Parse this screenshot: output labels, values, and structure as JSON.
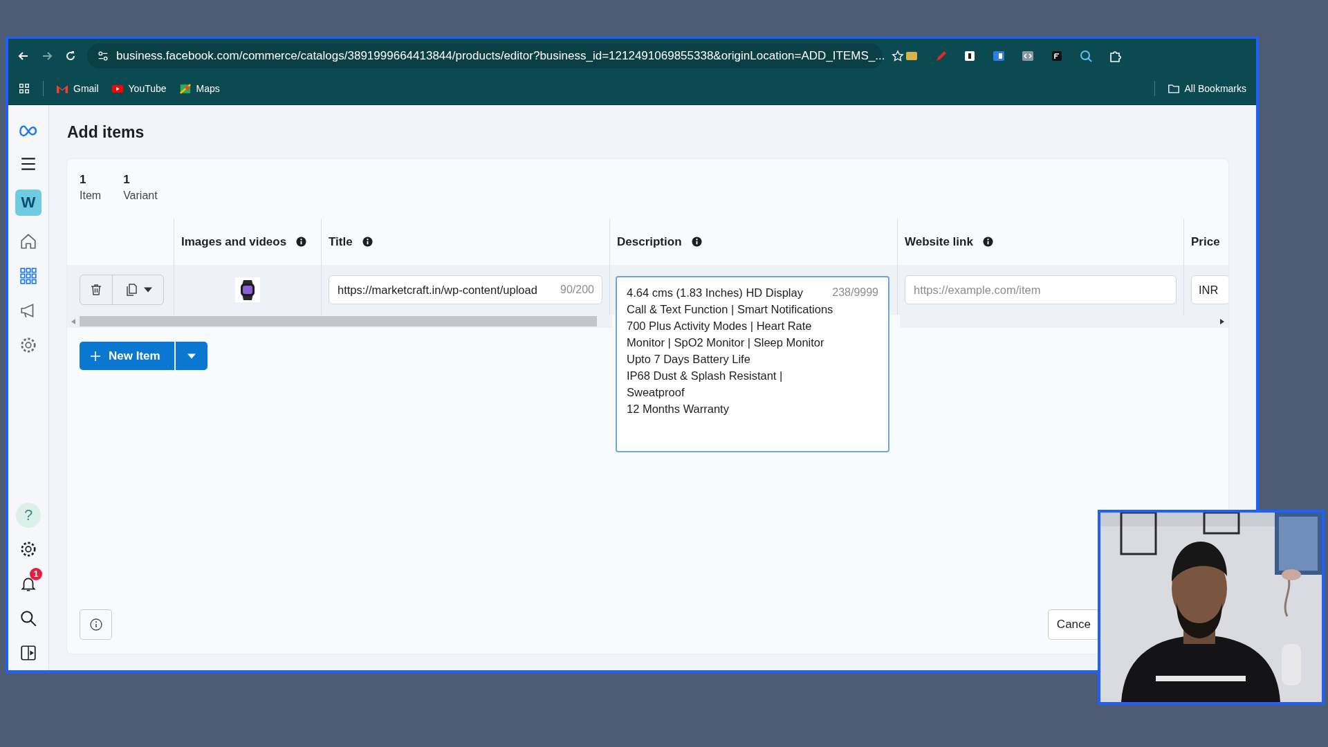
{
  "browser": {
    "url": "business.facebook.com/commerce/catalogs/3891999664413844/products/editor?business_id=1212491069855338&originLocation=ADD_ITEMS_...",
    "bookmarks": [
      {
        "label": "Gmail",
        "kind": "mail"
      },
      {
        "label": "YouTube",
        "kind": "video"
      },
      {
        "label": "Maps",
        "kind": "map"
      }
    ],
    "all_bookmarks": "All Bookmarks"
  },
  "sidebar": {
    "avatar": "W",
    "help": "?",
    "notifications": "1"
  },
  "page": {
    "title": "Add items",
    "counts": [
      {
        "value": "1",
        "label": "Item"
      },
      {
        "value": "1",
        "label": "Variant"
      }
    ],
    "table": {
      "columns": [
        {
          "label": "Images and videos",
          "info": true
        },
        {
          "label": "Title",
          "info": true
        },
        {
          "label": "Description",
          "info": true
        },
        {
          "label": "Website link",
          "info": true
        },
        {
          "label": "Price",
          "info": false
        }
      ],
      "row": {
        "title": "https://marketcraft.in/wp-content/upload",
        "title_count": "90/200",
        "description_lines": [
          "4.64 cms (1.83 Inches) HD Display",
          "Call & Text Function | Smart Notifications",
          "700 Plus Activity Modes | Heart Rate",
          "Monitor | SpO2 Monitor | Sleep Monitor",
          "Upto 7 Days Battery Life",
          "IP68 Dust & Splash Resistant |",
          "Sweatproof",
          "12 Months Warranty"
        ],
        "description_count": "238/9999",
        "website_placeholder": "https://example.com/item",
        "price_currency": "INR"
      }
    },
    "new_item": "New Item",
    "cancel": "Cance"
  }
}
